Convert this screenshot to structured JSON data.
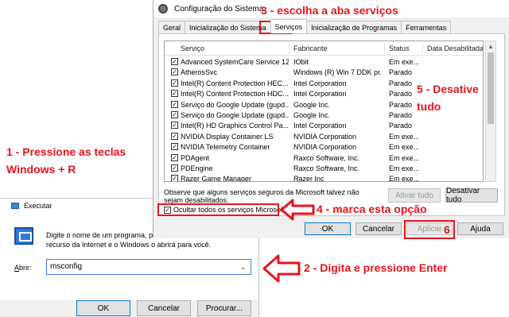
{
  "run": {
    "title": "Executar",
    "desc_line1": "Digite o nome de um programa, pasta, documento ou",
    "desc_line2": "recurso da Internet e o Windows o abrirá para você.",
    "label_key": "A",
    "label_rest": "brir:",
    "value": "msconfig",
    "ok": "OK",
    "cancel": "Cancelar",
    "browse": "Procurar..."
  },
  "config": {
    "title": "Configuração do Sistema",
    "tabs": [
      "Geral",
      "Inicialização do Sistema",
      "Serviços",
      "Inicialização de Programas",
      "Ferramentas"
    ],
    "active_tab": "Serviços",
    "columns": [
      "Serviço",
      "Fabricante",
      "Status",
      "Data Desabilitada"
    ],
    "services": [
      {
        "name": "Advanced SystemCare Service 12",
        "maker": "IObit",
        "status": "Em exe..."
      },
      {
        "name": "AtherosSvc",
        "maker": "Windows (R) Win 7 DDK pr...",
        "status": "Parado"
      },
      {
        "name": "Intel(R) Content Protection HEC...",
        "maker": "Intel Corporation",
        "status": "Parado"
      },
      {
        "name": "Intel(R) Content Protection HDC...",
        "maker": "Intel Corporation",
        "status": "Parado"
      },
      {
        "name": "Serviço do Google Update (gupd...",
        "maker": "Google Inc.",
        "status": "Parado"
      },
      {
        "name": "Serviço do Google Update (gupd...",
        "maker": "Google Inc.",
        "status": "Parado"
      },
      {
        "name": "Intel(R) HD Graphics Control Pa...",
        "maker": "Intel Corporation",
        "status": "Parado"
      },
      {
        "name": "NVIDIA Display Container LS",
        "maker": "NVIDIA Corporation",
        "status": "Em exe..."
      },
      {
        "name": "NVIDIA Telemetry Container",
        "maker": "NVIDIA Corporation",
        "status": "Em exe..."
      },
      {
        "name": "PDAgent",
        "maker": "Raxco Software, Inc.",
        "status": "Em exe..."
      },
      {
        "name": "PDEngine",
        "maker": "Raxco Software, Inc.",
        "status": "Em exe..."
      },
      {
        "name": "Razer Game Manager",
        "maker": "Razer Inc",
        "status": "Em exe..."
      }
    ],
    "note": "Observe que alguns serviços seguros da Microsoft talvez não sejam desabilitados.",
    "enable_all": "Ativar tudo",
    "disable_all": "Desativar tudo",
    "hide_ms": "Ocultar todos os serviços Microsoft",
    "ok": "OK",
    "cancel": "Cancelar",
    "apply": "Aplicar",
    "help": "Ajuda"
  },
  "annotations": {
    "step1_line1": "1 - Pressione as teclas",
    "step1_line2": "Windows + R",
    "step2": "2 - Digita e pressione Enter",
    "step3": "3 - escolha a aba serviços",
    "step4": "4 - marca esta opção",
    "step5_line1": "5 - Desative",
    "step5_line2": "tudo",
    "step6": "6"
  },
  "colors": {
    "annotation": "#e8141d",
    "accent": "#0078d7"
  }
}
